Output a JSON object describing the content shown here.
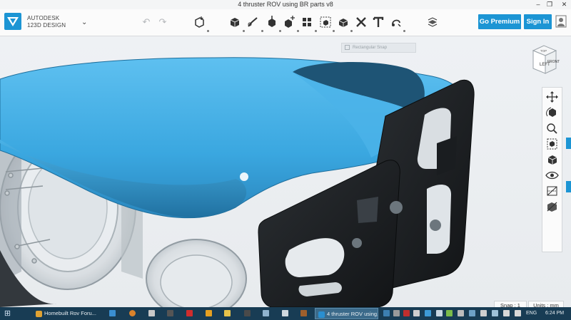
{
  "window": {
    "title": "4 thruster ROV using BR parts v8",
    "minimize": "–",
    "maximize": "❐",
    "close": "✕"
  },
  "brand": {
    "line1": "AUTODESK",
    "line2": "123D DESIGN",
    "caret": "⌄"
  },
  "toolbar": {
    "undo": "↶",
    "redo": "↷",
    "icons": [
      "transform-icon",
      "primitive-box-icon",
      "sketch-icon",
      "construct-icon",
      "modify-icon",
      "pattern-icon",
      "group-icon",
      "combine-icon",
      "measure-icon",
      "text-icon",
      "snap-icon",
      "material-icon"
    ],
    "go_premium_label": "Go Premium",
    "sign_in_label": "Sign In",
    "profile_icon": "profile-icon"
  },
  "viewport": {
    "snap_chip": "Rectangular Snap",
    "viewcube": {
      "top": "TOP",
      "left": "LEFT",
      "front": "FRONT"
    },
    "nav_tools": [
      "pan-icon",
      "orbit-icon",
      "zoom-icon",
      "fit-icon",
      "view-cube-icon",
      "visibility-icon",
      "materials-outline-icon",
      "wireframe-icon"
    ],
    "snap": "Snap : 1",
    "units": "Units : mm"
  },
  "taskbar": {
    "tasks": [
      {
        "label": "Homebuilt Rov Foru...",
        "color": "#e0a232",
        "active": false
      },
      {
        "label": "4 thruster ROV using...",
        "color": "#2a8fd0",
        "active": true
      }
    ],
    "lang": "ENG",
    "time": "6:24 PM",
    "colors": {
      "taskbar": "#183c54",
      "accent": "#1c95d4",
      "model_blue": "#3aa7e0",
      "model_dark": "#1c1f22"
    }
  }
}
